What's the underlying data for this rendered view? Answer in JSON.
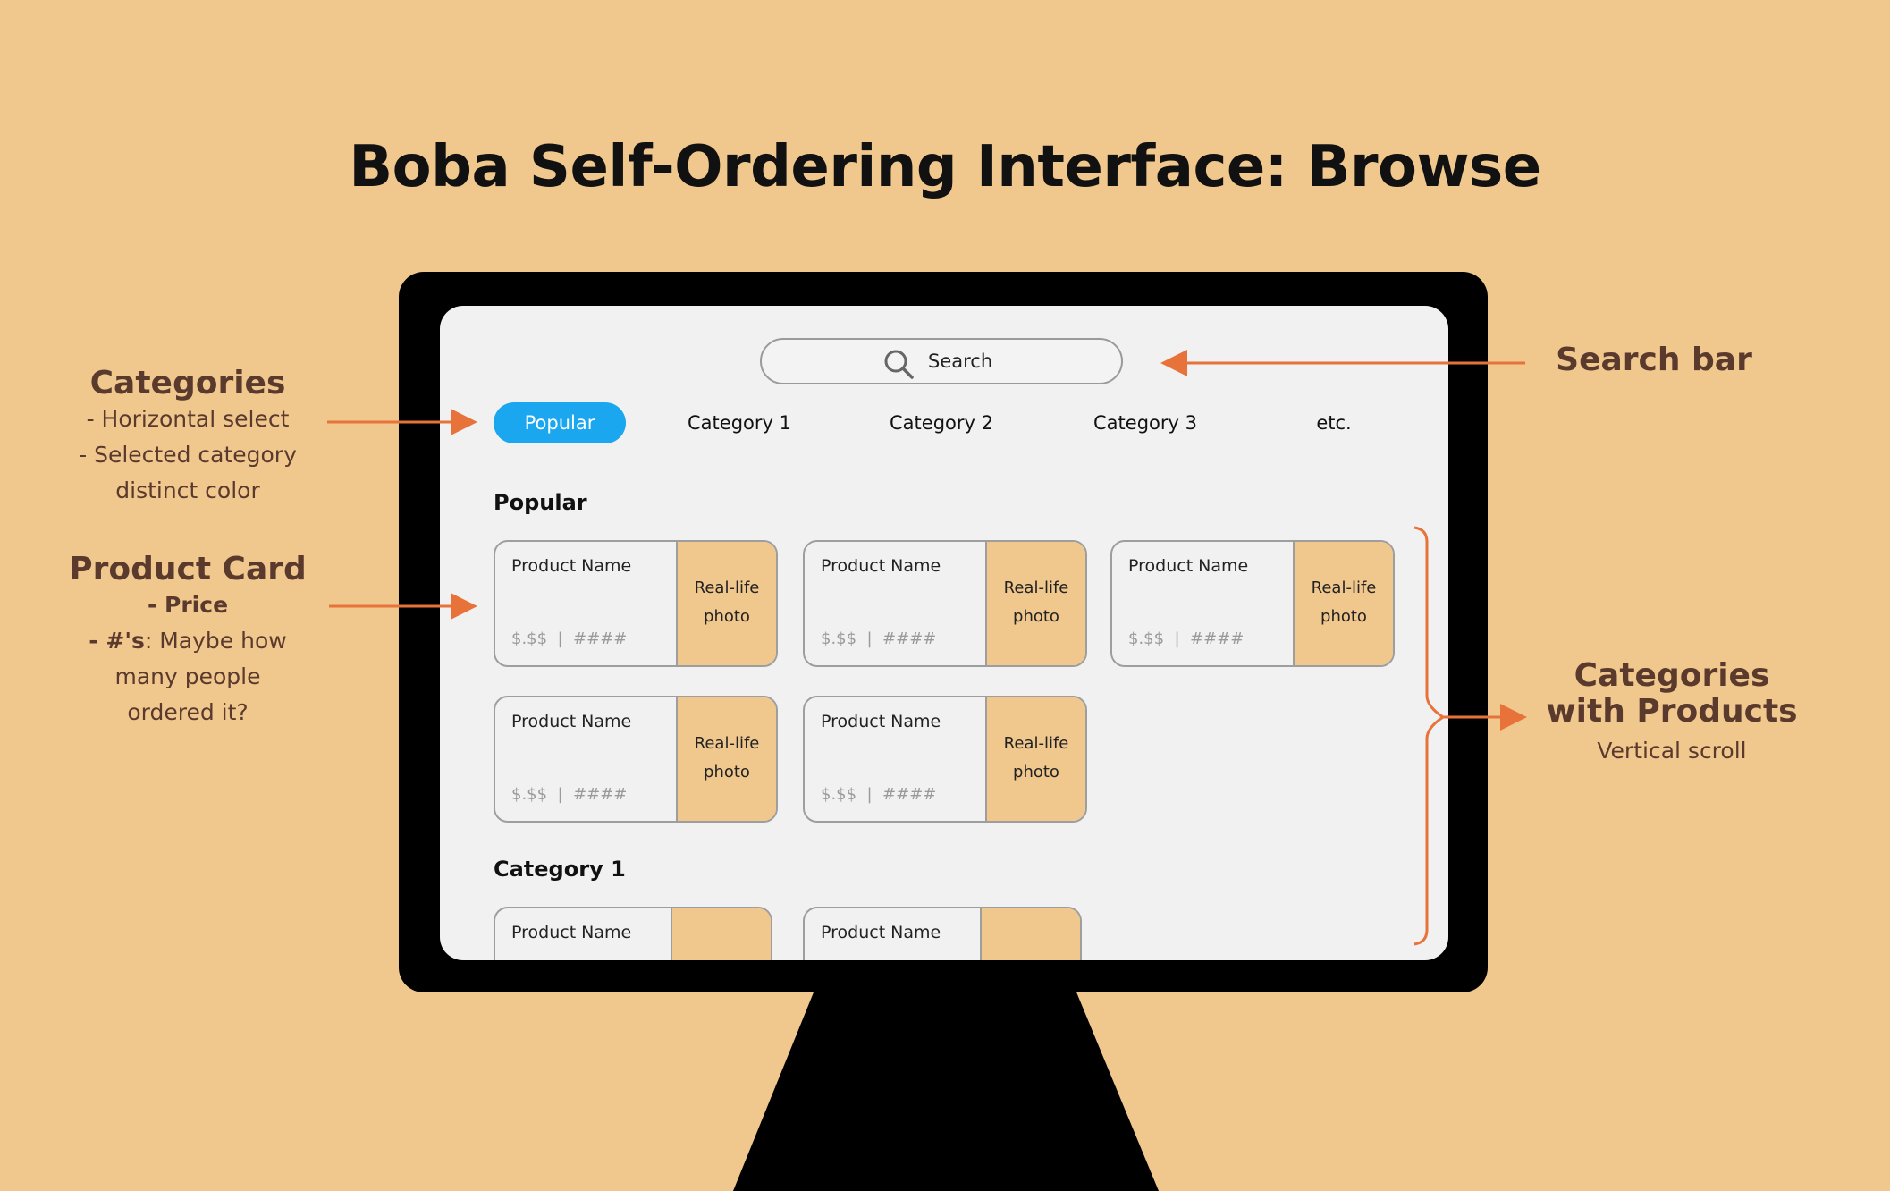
{
  "title": "Boba Self-Ordering Interface: Browse",
  "colors": {
    "background": "#f0c78d",
    "accent": "#1aa7f0",
    "arrow": "#e8733a",
    "annotation_text": "#5b3a2e"
  },
  "search": {
    "label": "Search",
    "icon": "search-icon"
  },
  "tabs": [
    {
      "label": "Popular",
      "selected": true
    },
    {
      "label": "Category 1",
      "selected": false
    },
    {
      "label": "Category 2",
      "selected": false
    },
    {
      "label": "Category 3",
      "selected": false
    },
    {
      "label": "etc.",
      "selected": false
    }
  ],
  "sections": [
    {
      "title": "Popular",
      "cards": [
        {
          "name": "Product Name",
          "price": "$.$$",
          "count": "####",
          "photo_line1": "Real-life",
          "photo_line2": "photo"
        },
        {
          "name": "Product Name",
          "price": "$.$$",
          "count": "####",
          "photo_line1": "Real-life",
          "photo_line2": "photo"
        },
        {
          "name": "Product Name",
          "price": "$.$$",
          "count": "####",
          "photo_line1": "Real-life",
          "photo_line2": "photo"
        },
        {
          "name": "Product Name",
          "price": "$.$$",
          "count": "####",
          "photo_line1": "Real-life",
          "photo_line2": "photo"
        },
        {
          "name": "Product Name",
          "price": "$.$$",
          "count": "####",
          "photo_line1": "Real-life",
          "photo_line2": "photo"
        }
      ]
    },
    {
      "title": "Category 1",
      "cards": [
        {
          "name": "Product Name"
        },
        {
          "name": "Product Name"
        }
      ]
    }
  ],
  "annotations": {
    "categories": {
      "heading": "Categories",
      "line1": "- Horizontal select",
      "line2": "- Selected category",
      "line3": "distinct color"
    },
    "product_card": {
      "heading": "Product Card",
      "line1": "- Price",
      "line2_bold": "- #'s",
      "line2_rest": ": Maybe how",
      "line3": "many people",
      "line4": "ordered it?"
    },
    "search_bar": {
      "heading": "Search bar"
    },
    "categories_products": {
      "heading1": "Categories",
      "heading2": "with Products",
      "line1": "Vertical scroll"
    }
  }
}
